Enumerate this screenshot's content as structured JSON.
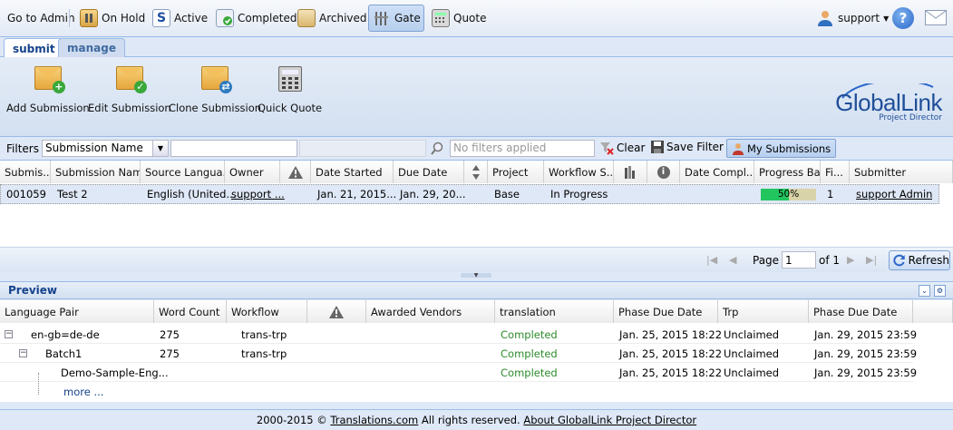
{
  "toolbar": {
    "go_to_admin": "Go to Admin",
    "on_hold": "On Hold",
    "active": "Active",
    "completed": "Completed",
    "archived": "Archived",
    "gate": "Gate",
    "quote": "Quote",
    "user": "support"
  },
  "tabs": {
    "submit": "submit",
    "manage": "manage"
  },
  "actions": {
    "add": "Add Submission",
    "edit": "Edit Submission",
    "clone": "Clone Submission",
    "quick_quote": "Quick Quote"
  },
  "logo": {
    "brand_a": "Glob",
    "brand_b": "al",
    "brand_c": "Link",
    "sub": "Project Director"
  },
  "filters": {
    "label": "Filters",
    "field": "Submission Name",
    "search_placeholder": "No filters applied",
    "clear": "Clear",
    "save_filter": "Save Filter",
    "my_submissions": "My Submissions"
  },
  "grid": {
    "headers": [
      "Submis...",
      "Submission Name",
      "Source Langua...",
      "Owner",
      "",
      "Date Started",
      "Due Date",
      "",
      "Project",
      "Workflow S...",
      "",
      "",
      "Date Compl...",
      "Progress Bar",
      "Fi...",
      "Submitter"
    ],
    "row": {
      "id": "001059",
      "name": "Test 2",
      "source": "English (United...",
      "owner": "support ...",
      "started": "Jan. 21, 2015...",
      "due": "Jan. 29, 20...",
      "project": "Base",
      "workflow": "In Progress",
      "progress": 50,
      "progress_label": "50%",
      "files": "1",
      "submitter": "support Admin"
    }
  },
  "pager": {
    "page_label": "Page",
    "page": "1",
    "of": "of 1",
    "refresh": "Refresh"
  },
  "preview": {
    "title": "Preview",
    "headers": [
      "Language Pair",
      "Word Count",
      "Workflow",
      "",
      "Awarded Vendors",
      "translation",
      "Phase Due Date",
      "Trp",
      "Phase Due Date"
    ],
    "rows": [
      {
        "name": "en-gb=de-de",
        "words": "275",
        "workflow": "trans-trp",
        "translation": "Completed",
        "phase_due": "Jan. 25, 2015 18:22",
        "trp": "Unclaimed",
        "phase_due2": "Jan. 29, 2015 23:59"
      },
      {
        "name": "Batch1",
        "words": "275",
        "workflow": "trans-trp",
        "translation": "Completed",
        "phase_due": "Jan. 25, 2015 18:22",
        "trp": "Unclaimed",
        "phase_due2": "Jan. 29, 2015 23:59"
      },
      {
        "name": "Demo-Sample-Eng...",
        "words": "",
        "workflow": "",
        "translation": "Completed",
        "phase_due": "Jan. 25, 2015 18:22",
        "trp": "Unclaimed",
        "phase_due2": "Jan. 29, 2015 23:59"
      }
    ],
    "more": "more ..."
  },
  "footer": {
    "copyright": "2000-2015 © ",
    "site": "Translations.com",
    "rights": " All rights reserved. ",
    "about": "About GlobalLink Project Director"
  },
  "colors": {
    "accent": "#15428b",
    "progress": "#22c55e",
    "completed": "#2d8c2d"
  }
}
